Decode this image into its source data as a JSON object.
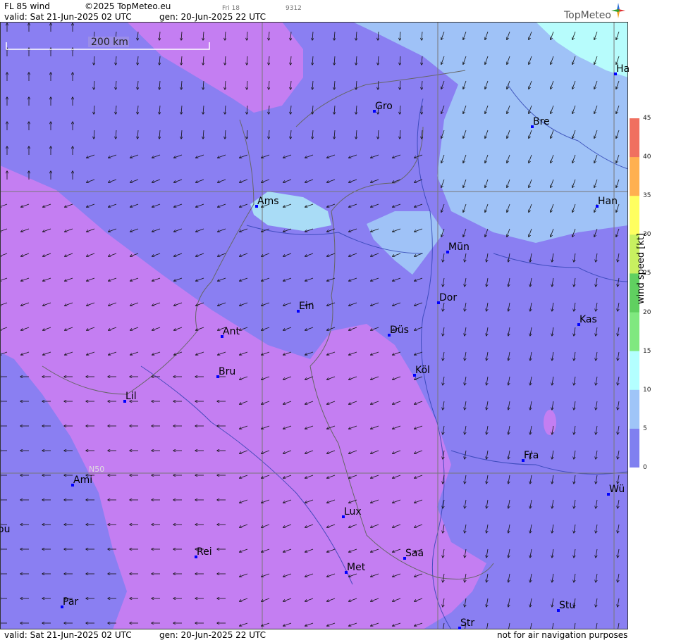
{
  "header": {
    "product": "FL 85 wind",
    "copyright": "©2025 TopMeteo.eu",
    "run_small": "Fri 18",
    "code_small": "9312",
    "valid": "valid:  Sat  21-Jun-2025  02 UTC",
    "gen": "gen: 20-Jun-2025 22 UTC",
    "logo": "TopMeteo"
  },
  "footer": {
    "valid": "valid:  Sat  21-Jun-2025  02 UTC",
    "gen": "gen: 20-Jun-2025 22 UTC",
    "disclaimer": "not for air navigation purposes"
  },
  "scale_bar": {
    "label": "200 km"
  },
  "grid_label": "N50",
  "legend": {
    "title": "wind  speed  [kt]",
    "ticks": [
      "45",
      "40",
      "35",
      "30",
      "25",
      "20",
      "15",
      "10",
      "5",
      "0"
    ],
    "colors": {
      "0": "#c77df0",
      "5": "#8080f0",
      "10": "#9fc5f8",
      "15": "#b3ffff",
      "20": "#80e880",
      "25": "#60d060",
      "30": "#c8f060",
      "35": "#ffff60",
      "40": "#ffb050",
      "45": "#f07060"
    }
  },
  "cities": [
    {
      "name": "Gro"
    },
    {
      "name": "Bre"
    },
    {
      "name": "Ha"
    },
    {
      "name": "Ams"
    },
    {
      "name": "Han"
    },
    {
      "name": "Mün"
    },
    {
      "name": "Dor"
    },
    {
      "name": "Ein"
    },
    {
      "name": "Kas"
    },
    {
      "name": "Ant"
    },
    {
      "name": "Düs"
    },
    {
      "name": "Bru"
    },
    {
      "name": "Köl"
    },
    {
      "name": "Lil"
    },
    {
      "name": "Fra"
    },
    {
      "name": "Ami"
    },
    {
      "name": "Wü"
    },
    {
      "name": "ou"
    },
    {
      "name": "Lux"
    },
    {
      "name": "Rei"
    },
    {
      "name": "Saa"
    },
    {
      "name": "Met"
    },
    {
      "name": "Par"
    },
    {
      "name": "Stu"
    },
    {
      "name": "Str"
    }
  ]
}
